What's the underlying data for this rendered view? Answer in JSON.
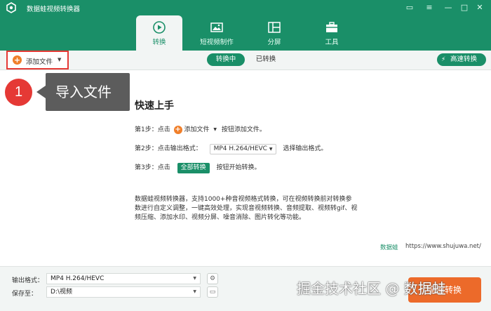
{
  "app": {
    "title": "数据蛙视频转换器"
  },
  "nav": {
    "tabs": [
      {
        "label": "转换"
      },
      {
        "label": "短视频制作"
      },
      {
        "label": "分屏"
      },
      {
        "label": "工具"
      }
    ]
  },
  "toolbar": {
    "add_file": "添加文件",
    "seg_converting": "转换中",
    "seg_converted": "已转换",
    "fast_convert": "高速转换"
  },
  "callout": {
    "number": "1",
    "text": "导入文件"
  },
  "quickstart": {
    "title": "快速上手",
    "step1_prefix": "第1步：点击",
    "step1_button": "添加文件",
    "step1_suffix": "按钮添加文件。",
    "step2_prefix": "第2步：点击输出格式：",
    "step2_format": "MP4 H.264/HEVC",
    "step2_suffix": "选择输出格式。",
    "step3_prefix": "第3步：点击",
    "step3_button": "全部转换",
    "step3_suffix": "按钮开始转换。",
    "description": "数据蛙视频转换器，支持1000+种音视频格式转换，可在视频转换前对转换参数进行自定义调整，一键高效处理，实现音视频转换、音频提取、视频转gif、视频压缩、添加水印、视频分屏、噪音消除、图片转化等功能。",
    "brand": "数据蛙",
    "url": "https://www.shujuwa.net/"
  },
  "bottom": {
    "output_label": "输出格式：",
    "output_value": "MP4 H.264/HEVC",
    "save_label": "保存至：",
    "save_value": "D:\\视频",
    "convert_all": "全部转换"
  },
  "watermark": "掘金技术社区 @ 数据蛙",
  "colors": {
    "brand_green": "#1a8f68",
    "accent_orange": "#ec6a2a",
    "highlight_red": "#e53935"
  }
}
